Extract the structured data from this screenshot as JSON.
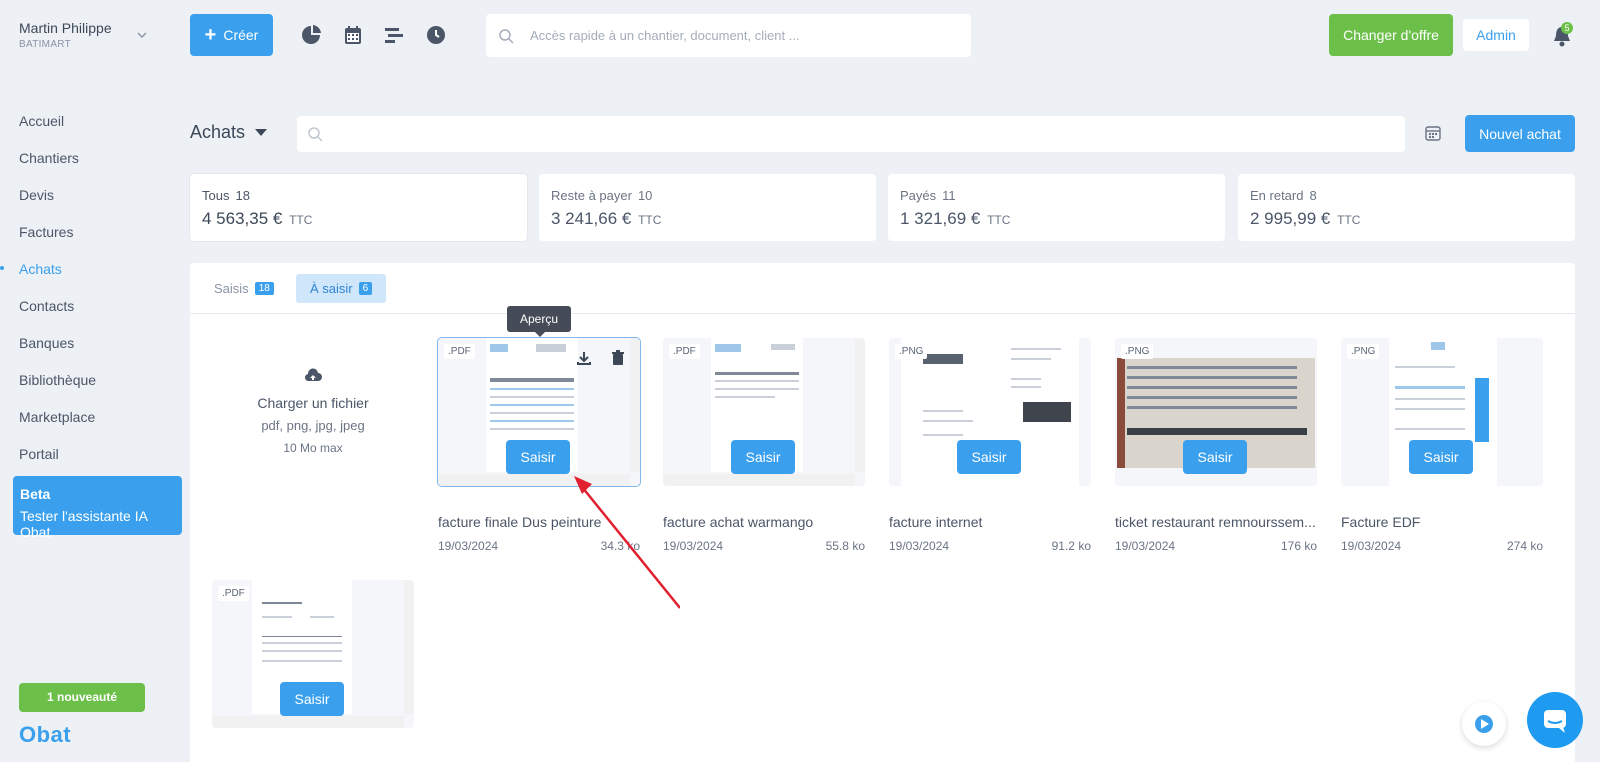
{
  "user": {
    "name": "Martin Philippe",
    "company": "BATIMART"
  },
  "topbar": {
    "create_label": "Créer",
    "search_placeholder": "Accès rapide à un chantier, document, client ...",
    "offer_label": "Changer d'offre",
    "admin_label": "Admin",
    "notifications_count": "5"
  },
  "sidebar": {
    "items": [
      {
        "label": "Accueil"
      },
      {
        "label": "Chantiers"
      },
      {
        "label": "Devis"
      },
      {
        "label": "Factures"
      },
      {
        "label": "Achats"
      },
      {
        "label": "Contacts"
      },
      {
        "label": "Banques"
      },
      {
        "label": "Bibliothèque"
      },
      {
        "label": "Marketplace"
      },
      {
        "label": "Portail"
      }
    ],
    "beta_title": "Beta",
    "beta_text": "Tester l'assistante IA Obat",
    "news_label": "1 nouveauté",
    "logo": "Obat"
  },
  "page": {
    "title": "Achats",
    "new_label": "Nouvel achat"
  },
  "summary": [
    {
      "label": "Tous",
      "count": "18",
      "amount": "4 563,35 €",
      "unit": "TTC"
    },
    {
      "label": "Reste à payer",
      "count": "10",
      "amount": "3 241,66 €",
      "unit": "TTC"
    },
    {
      "label": "Payés",
      "count": "11",
      "amount": "1 321,69 €",
      "unit": "TTC"
    },
    {
      "label": "En retard",
      "count": "8",
      "amount": "2 995,99 €",
      "unit": "TTC"
    }
  ],
  "tabs": [
    {
      "label": "Saisis",
      "count": "18"
    },
    {
      "label": "À saisir",
      "count": "6"
    }
  ],
  "upload": {
    "title": "Charger un fichier",
    "formats": "pdf, png, jpg, jpeg",
    "max": "10 Mo max"
  },
  "tooltip": "Aperçu",
  "action_label": "Saisir",
  "documents": [
    {
      "type": ".PDF",
      "name": "facture finale Dus peinture",
      "date": "19/03/2024",
      "size": "34.3 ko"
    },
    {
      "type": ".PDF",
      "name": "facture achat warmango",
      "date": "19/03/2024",
      "size": "55.8 ko"
    },
    {
      "type": ".PNG",
      "name": "facture internet",
      "date": "19/03/2024",
      "size": "91.2 ko"
    },
    {
      "type": ".PNG",
      "name": "ticket restaurant remnourssem...",
      "date": "19/03/2024",
      "size": "176 ko"
    },
    {
      "type": ".PNG",
      "name": "Facture EDF",
      "date": "19/03/2024",
      "size": "274 ko"
    },
    {
      "type": ".PDF",
      "name": "",
      "date": "",
      "size": ""
    }
  ],
  "colors": {
    "primary": "#3aa0ee",
    "success": "#6cc04a",
    "annotation": "#e0202e"
  }
}
